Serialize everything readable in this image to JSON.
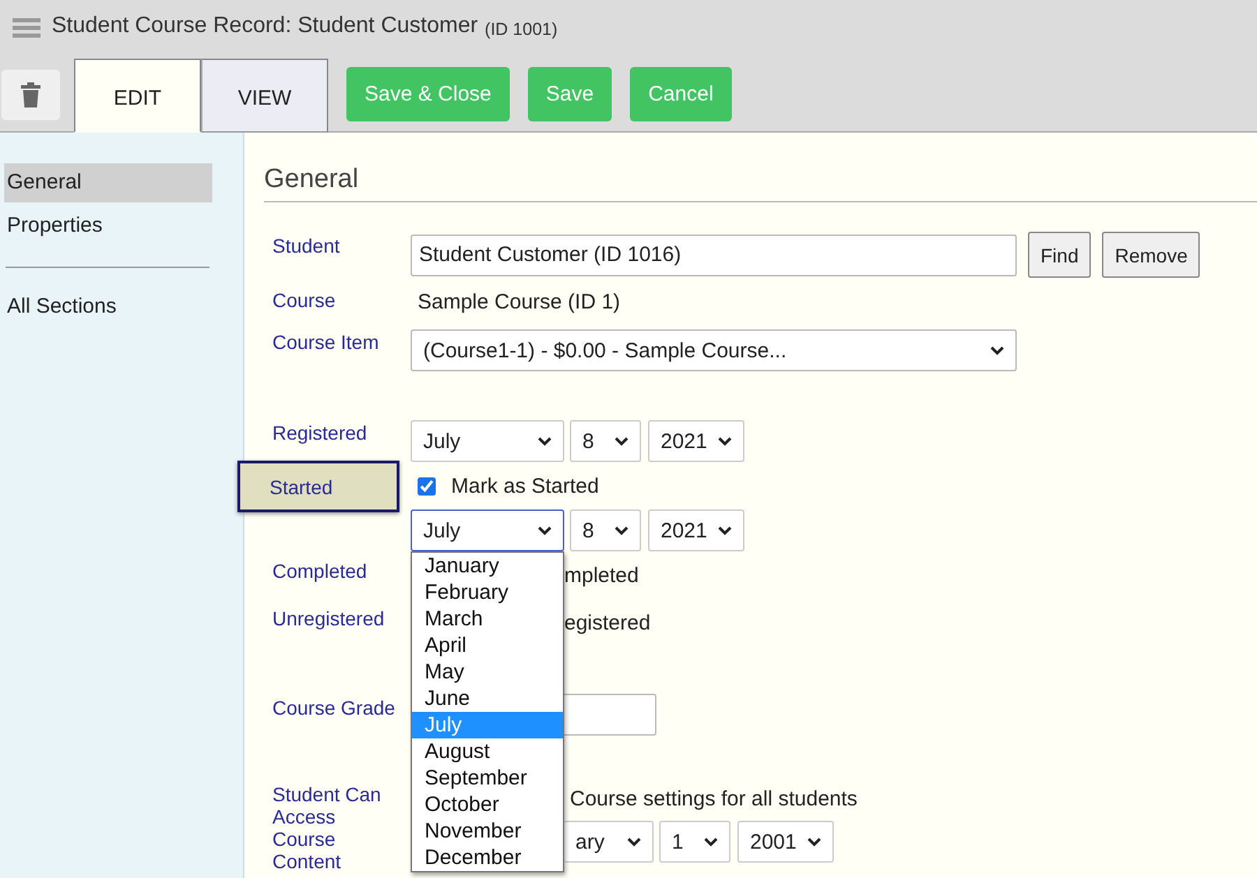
{
  "window": {
    "title": "Student Course Record: Student Customer",
    "title_id": "(ID 1001)"
  },
  "tabs": [
    {
      "label": "EDIT",
      "selected": true
    },
    {
      "label": "VIEW",
      "selected": false
    }
  ],
  "buttons": [
    "Save & Close",
    "Save",
    "Cancel"
  ],
  "sidebar": {
    "groups": [
      [
        {
          "label": "General",
          "selected": true
        },
        {
          "label": "Properties",
          "selected": false
        }
      ],
      [
        {
          "label": "All Sections",
          "selected": false
        }
      ]
    ]
  },
  "section_title": "General",
  "fields": [
    {
      "kind": "input",
      "label": "Student",
      "value": "Student Customer (ID 1016)",
      "buttons": [
        "Find",
        "Remove"
      ]
    },
    {
      "kind": "static",
      "label": "Course",
      "value": "Sample Course (ID 1)"
    },
    {
      "kind": "select",
      "label": "Course Item",
      "value": "(Course1-1) - $0.00 - Sample Course..."
    },
    {
      "kind": "date",
      "label": "Registered",
      "month": "July",
      "day": "8",
      "year": "2021",
      "focused": false
    },
    {
      "kind": "checkbox",
      "label": "Started",
      "highlighted": true,
      "checked": true,
      "text": "Mark as Started"
    },
    {
      "kind": "date",
      "month": "July",
      "day": "8",
      "year": "2021",
      "focused": true
    },
    {
      "kind": "covered_text",
      "label": "Completed",
      "text": "mpleted"
    },
    {
      "kind": "covered_text",
      "label": "Unregistered",
      "text": "egistered"
    },
    {
      "kind": "covered_input",
      "label": "Course Grade"
    },
    {
      "kind": "covered_text_date",
      "label": "Student Can Access Course Content",
      "text": "Course settings for all students",
      "month": "ary",
      "day": "1",
      "year": "2001"
    }
  ],
  "dropdown": {
    "options": [
      {
        "label": "January",
        "selected": false
      },
      {
        "label": "February",
        "selected": false
      },
      {
        "label": "March",
        "selected": false
      },
      {
        "label": "April",
        "selected": false
      },
      {
        "label": "May",
        "selected": false
      },
      {
        "label": "June",
        "selected": false
      },
      {
        "label": "July",
        "selected": true
      },
      {
        "label": "August",
        "selected": false
      },
      {
        "label": "September",
        "selected": false
      },
      {
        "label": "October",
        "selected": false
      },
      {
        "label": "November",
        "selected": false
      },
      {
        "label": "December",
        "selected": false
      }
    ]
  }
}
